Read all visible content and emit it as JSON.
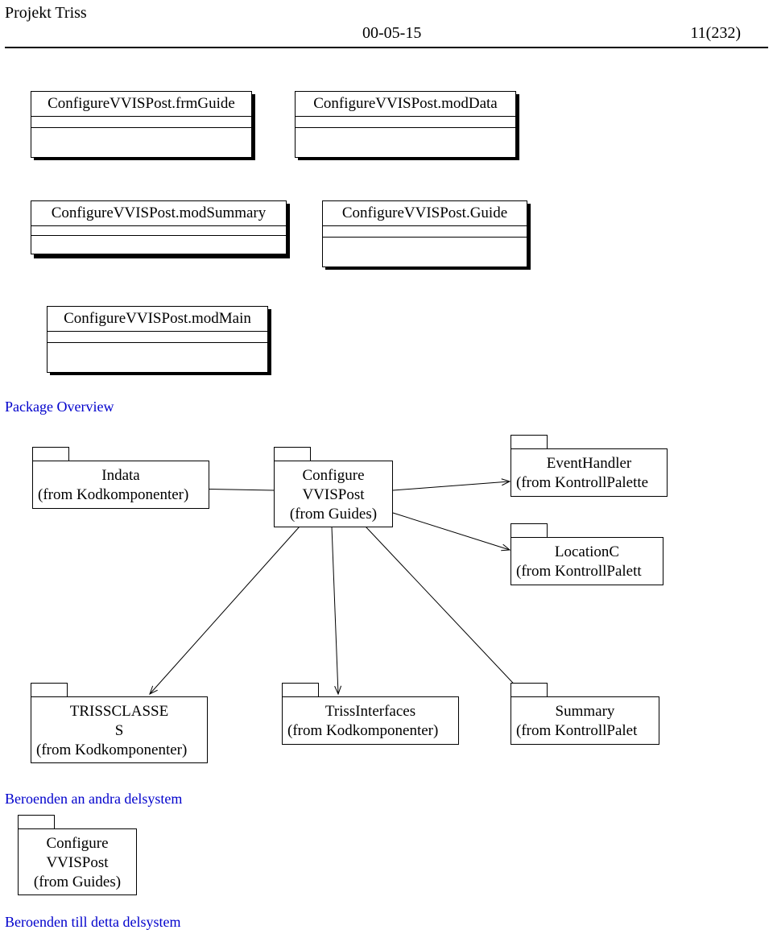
{
  "header": {
    "title": "Projekt Triss",
    "date": "00-05-15",
    "page": "11(232)"
  },
  "classBoxes": {
    "frmGuide": "ConfigureVVISPost.frmGuide",
    "modData": "ConfigureVVISPost.modData",
    "modSummary": "ConfigureVVISPost.modSummary",
    "guide": "ConfigureVVISPost.Guide",
    "modMain": "ConfigureVVISPost.modMain"
  },
  "sections": {
    "packageOverview": "Package Overview",
    "beroendenAndra": "Beroenden an andra delsystem",
    "beroendenTill": "Beroenden till detta delsystem"
  },
  "packages": {
    "indata": {
      "name": "Indata",
      "from": "(from Kodkomponenter)"
    },
    "configure": {
      "name": "Configure",
      "name2": "VVISPost",
      "from": "(from Guides)"
    },
    "eventHandler": {
      "name": "EventHandler",
      "from": "(from KontrollPalette"
    },
    "locationC": {
      "name": "LocationC",
      "from": "(from KontrollPalett"
    },
    "trissClasses": {
      "name": "TRISSCLASSE",
      "name2": "S",
      "from": "(from Kodkomponenter)"
    },
    "trissInterfaces": {
      "name": "TrissInterfaces",
      "from": "(from Kodkomponenter)"
    },
    "summary": {
      "name": "Summary",
      "from": "(from KontrollPalet"
    },
    "configure2": {
      "name": "Configure",
      "name2": "VVISPost",
      "from": "(from Guides)"
    }
  }
}
